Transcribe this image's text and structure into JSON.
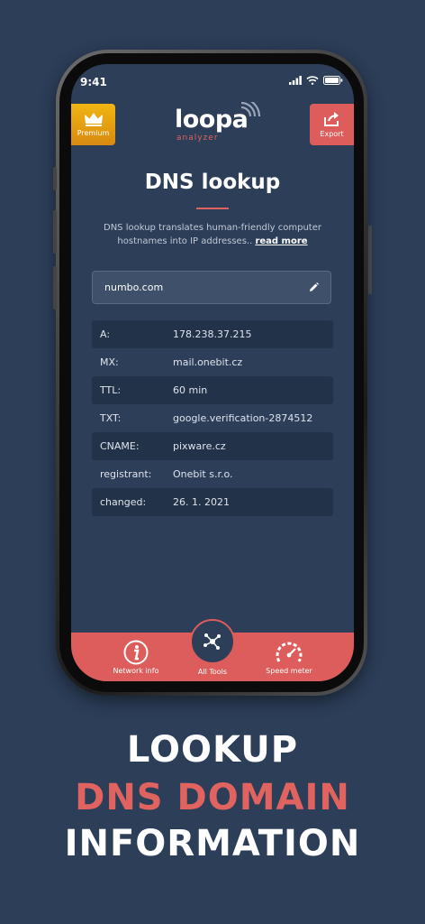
{
  "status": {
    "time": "9:41"
  },
  "header": {
    "premium_label": "Premium",
    "export_label": "Export",
    "logo_main": "loopa",
    "logo_sub": "analyzer"
  },
  "page": {
    "title": "DNS lookup",
    "description": "DNS lookup translates human-friendly computer hostnames into IP addresses..",
    "read_more": "read more"
  },
  "search": {
    "value": "numbo.com"
  },
  "records": [
    {
      "key": "A:",
      "value": "178.238.37.215"
    },
    {
      "key": "MX:",
      "value": "mail.onebit.cz"
    },
    {
      "key": "TTL:",
      "value": "60 min"
    },
    {
      "key": "TXT:",
      "value": "google.verification-2874512"
    },
    {
      "key": "CNAME:",
      "value": "pixware.cz"
    },
    {
      "key": "registrant:",
      "value": "Onebit s.r.o."
    },
    {
      "key": "changed:",
      "value": "26. 1. 2021"
    }
  ],
  "tabs": {
    "network_info": "Network info",
    "all_tools": "All Tools",
    "speed_meter": "Speed meter"
  },
  "headline": {
    "line1": "LOOKUP",
    "line2": "DNS DOMAIN",
    "line3": "INFORMATION"
  },
  "colors": {
    "accent": "#dc5d5b",
    "background": "#2c3e58",
    "premium": "#f0b512"
  }
}
